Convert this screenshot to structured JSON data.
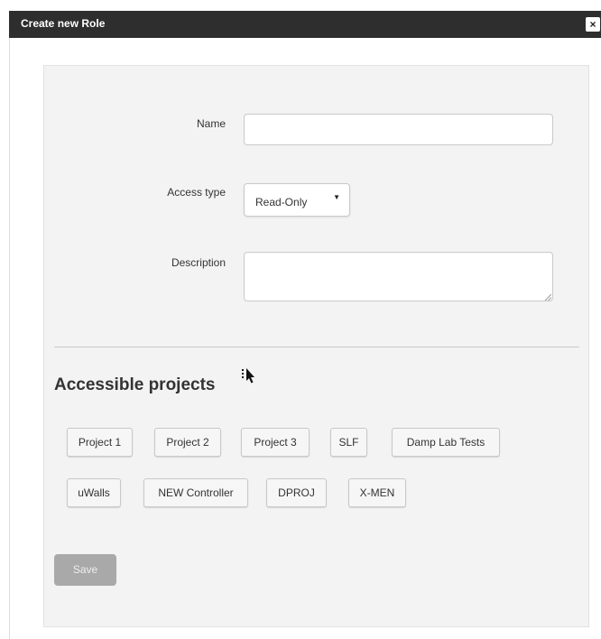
{
  "dialog": {
    "title": "Create new Role",
    "close_glyph": "×"
  },
  "form": {
    "name_label": "Name",
    "name_value": "",
    "access_label": "Access type",
    "access_value": "Read-Only",
    "access_arrow": "▼",
    "description_label": "Description",
    "description_value": ""
  },
  "projects": {
    "title": "Accessible projects",
    "items": [
      {
        "label": "Project 1"
      },
      {
        "label": "Project 2"
      },
      {
        "label": "Project 3"
      },
      {
        "label": "SLF"
      },
      {
        "label": "Damp Lab Tests"
      },
      {
        "label": "uWalls"
      },
      {
        "label": "NEW Controller"
      },
      {
        "label": "DPROJ"
      },
      {
        "label": "X-MEN"
      }
    ]
  },
  "actions": {
    "save_label": "Save",
    "save_enabled": false
  },
  "icons": [
    "close-icon",
    "dropdown-arrow-icon",
    "resize-grip-icon",
    "cursor-icon"
  ],
  "colors": {
    "titlebar_bg": "#2e2e2e",
    "panel_bg": "#f3f3f3",
    "save_disabled_bg": "#a9a9a9"
  }
}
